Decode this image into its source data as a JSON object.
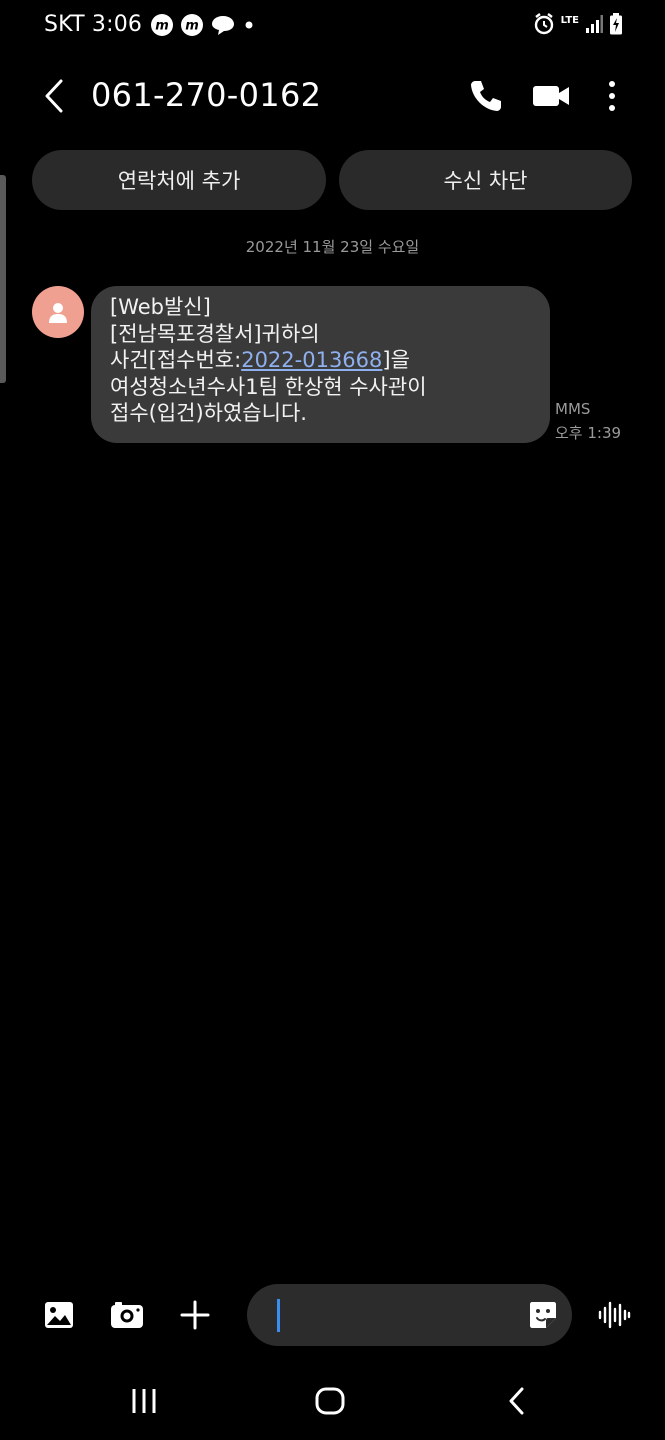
{
  "status_bar": {
    "carrier_time": "SKT 3:06",
    "network": "LTE"
  },
  "header": {
    "title": "061-270-0162"
  },
  "actions": {
    "add_contact": "연락처에 추가",
    "block": "수신 차단"
  },
  "conversation": {
    "date": "2022년 11월 23일 수요일",
    "messages": [
      {
        "line1": "[Web발신]",
        "line2": "[전남목포경찰서]귀하의",
        "line3_prefix": "사건[접수번호:",
        "line3_link": "2022-013668",
        "line3_suffix": "]을",
        "line4": "여성청소년수사1팀 한상현 수사관이",
        "line5": "접수(입건)하였습니다.",
        "type": "MMS",
        "time": "오후 1:39"
      }
    ]
  },
  "composer": {
    "placeholder": ""
  },
  "colors": {
    "background": "#000000",
    "bubble": "#3a3a3a",
    "pill": "#2a2a2a",
    "avatar": "#f0a091",
    "link": "#8fb0ee",
    "caret": "#3b8df0"
  }
}
